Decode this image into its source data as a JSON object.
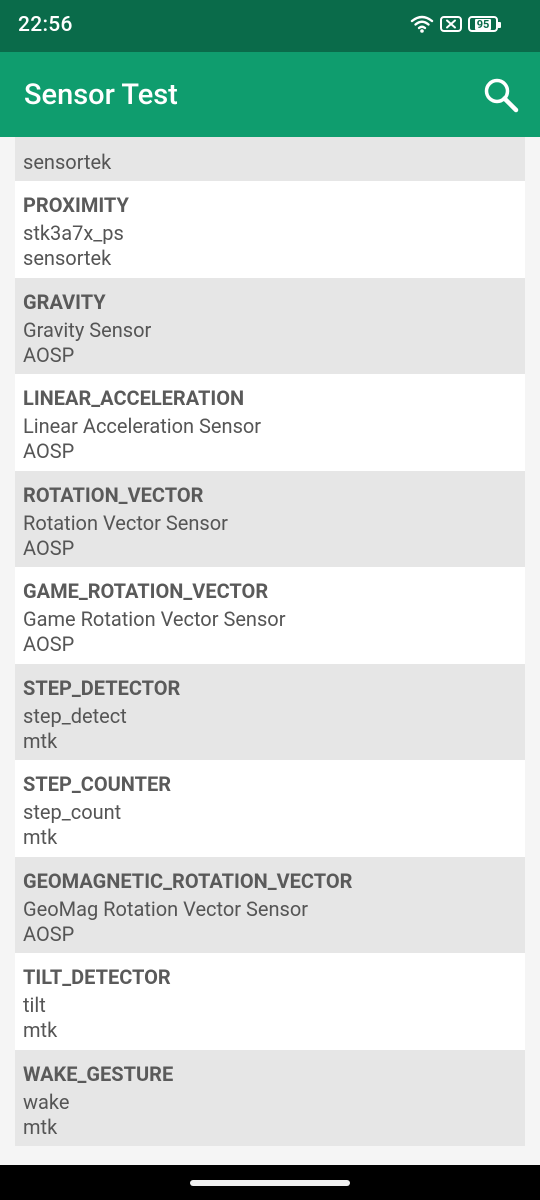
{
  "status_bar": {
    "time": "22:56",
    "battery": "95",
    "icons": [
      "wifi-icon",
      "sim-no-signal-icon",
      "battery-icon"
    ]
  },
  "app_bar": {
    "title": "Sensor Test",
    "search_icon": "search-icon"
  },
  "partial_item": {
    "vendor": "sensortek"
  },
  "sensors": [
    {
      "type": "PROXIMITY",
      "name": "stk3a7x_ps",
      "vendor": "sensortek"
    },
    {
      "type": "GRAVITY",
      "name": "Gravity Sensor",
      "vendor": "AOSP"
    },
    {
      "type": "LINEAR_ACCELERATION",
      "name": "Linear Acceleration Sensor",
      "vendor": "AOSP"
    },
    {
      "type": "ROTATION_VECTOR",
      "name": "Rotation Vector Sensor",
      "vendor": "AOSP"
    },
    {
      "type": "GAME_ROTATION_VECTOR",
      "name": "Game Rotation Vector Sensor",
      "vendor": "AOSP"
    },
    {
      "type": "STEP_DETECTOR",
      "name": "step_detect",
      "vendor": "mtk"
    },
    {
      "type": "STEP_COUNTER",
      "name": "step_count",
      "vendor": "mtk"
    },
    {
      "type": "GEOMAGNETIC_ROTATION_VECTOR",
      "name": "GeoMag Rotation Vector Sensor",
      "vendor": "AOSP"
    },
    {
      "type": "TILT_DETECTOR",
      "name": "tilt",
      "vendor": "mtk"
    },
    {
      "type": "WAKE_GESTURE",
      "name": "wake",
      "vendor": "mtk"
    }
  ],
  "colors": {
    "status_bar": "#0a6b4a",
    "app_bar": "#0f9d6e",
    "row_shaded": "#e6e6e6",
    "row_plain": "#ffffff",
    "text": "#555555"
  }
}
